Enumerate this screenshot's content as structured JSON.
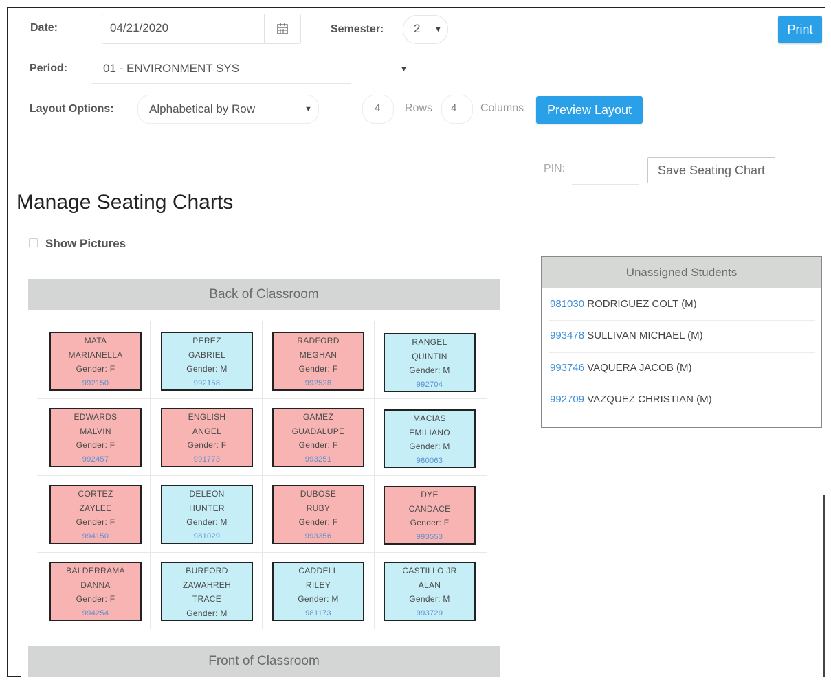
{
  "form": {
    "date_label": "Date:",
    "date_value": "04/21/2020",
    "calendar_icon": "calendar-icon",
    "semester_label": "Semester:",
    "semester_value": "2",
    "period_label": "Period:",
    "period_value": "01 - ENVIRONMENT SYS",
    "layout_label": "Layout Options:",
    "layout_value": "Alphabetical by Row",
    "rows_value": "4",
    "rows_label": "Rows",
    "columns_value": "4",
    "columns_label": "Columns",
    "preview_label": "Preview Layout",
    "print_label": "Print",
    "pin_label": "PIN:",
    "save_label": "Save Seating Chart"
  },
  "page": {
    "title": "Manage Seating Charts",
    "show_pictures_label": "Show Pictures"
  },
  "classroom": {
    "back_label": "Back of Classroom",
    "front_label": "Front of Classroom",
    "seats": [
      {
        "last": "MATA",
        "first": "MARIANELLA",
        "gender": "Gender: F",
        "id": "992150",
        "color": "#f7b4b2"
      },
      {
        "last": "PEREZ",
        "first": "GABRIEL",
        "gender": "Gender: M",
        "id": "992158",
        "color": "#c6eef7"
      },
      {
        "last": "RADFORD",
        "first": "MEGHAN",
        "gender": "Gender: F",
        "id": "992528",
        "color": "#f7b4b2"
      },
      {
        "last": "RANGEL",
        "first": "QUINTIN",
        "gender": "Gender: M",
        "id": "992704",
        "color": "#c6eef7"
      },
      {
        "last": "EDWARDS",
        "first": "MALVIN",
        "gender": "Gender: F",
        "id": "992457",
        "color": "#f7b4b2"
      },
      {
        "last": "ENGLISH",
        "first": "ANGEL",
        "gender": "Gender: F",
        "id": "991773",
        "color": "#f7b4b2"
      },
      {
        "last": "GAMEZ",
        "first": "GUADALUPE",
        "gender": "Gender: F",
        "id": "993251",
        "color": "#f7b4b2"
      },
      {
        "last": "MACIAS",
        "first": "EMILIANO",
        "gender": "Gender: M",
        "id": "980063",
        "color": "#c6eef7"
      },
      {
        "last": "CORTEZ",
        "first": "ZAYLEE",
        "gender": "Gender: F",
        "id": "994150",
        "color": "#f7b4b2"
      },
      {
        "last": "DELEON",
        "first": "HUNTER",
        "gender": "Gender: M",
        "id": "981029",
        "color": "#c6eef7"
      },
      {
        "last": "DUBOSE",
        "first": "RUBY",
        "gender": "Gender: F",
        "id": "993356",
        "color": "#f7b4b2"
      },
      {
        "last": "DYE",
        "first": "CANDACE",
        "gender": "Gender: F",
        "id": "993553",
        "color": "#f7b4b2"
      },
      {
        "last": "BALDERRAMA",
        "first": "DANNA",
        "gender": "Gender: F",
        "id": "994254",
        "color": "#f7b4b2"
      },
      {
        "last": "BURFORD",
        "first": "ZAWAHREH",
        "third": "TRACE",
        "gender": "Gender: M",
        "id": "",
        "color": "#c6eef7"
      },
      {
        "last": "CADDELL",
        "first": "RILEY",
        "gender": "Gender: M",
        "id": "981173",
        "color": "#c6eef7"
      },
      {
        "last": "CASTILLO JR",
        "first": "ALAN",
        "gender": "Gender: M",
        "id": "993729",
        "color": "#c6eef7"
      }
    ]
  },
  "unassigned": {
    "header": "Unassigned Students",
    "students": [
      {
        "id": "981030",
        "name": "RODRIGUEZ COLT (M)"
      },
      {
        "id": "993478",
        "name": "SULLIVAN MICHAEL (M)"
      },
      {
        "id": "993746",
        "name": "VAQUERA JACOB (M)"
      },
      {
        "id": "992709",
        "name": "VAZQUEZ CHRISTIAN (M)"
      }
    ]
  },
  "colors": {
    "accent": "#2aa0e8",
    "female_seat": "#f7b4b2",
    "male_seat": "#c6eef7"
  }
}
